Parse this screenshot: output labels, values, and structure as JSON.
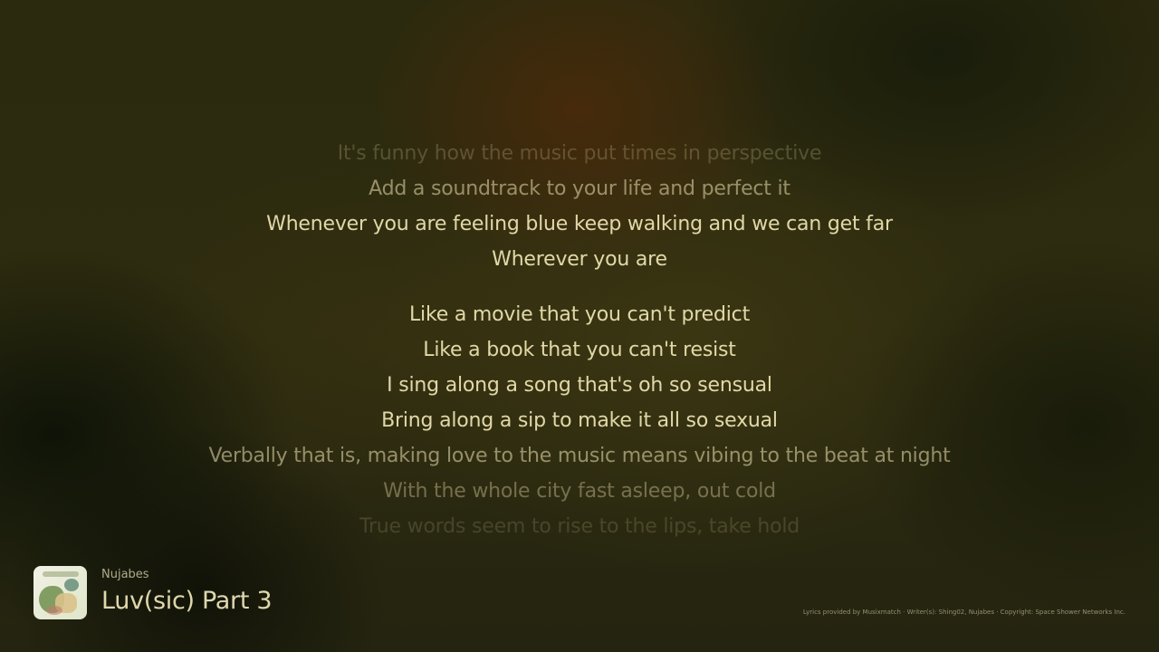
{
  "lyrics": {
    "previous": [
      "It's funny how the music put times in perspective",
      "Add a soundtrack to your life and perfect it",
      "Whenever you are feeling blue keep walking and we can get far",
      "Wherever you are"
    ],
    "current": [
      "Like a movie that you can't predict",
      "Like a book that you can't resist",
      "I sing along a song that's oh so sensual",
      "Bring along a sip to make it all so sexual",
      "Verbally that is, making love to the music means vibing to the beat at night"
    ],
    "upcoming": [
      "With the whole city fast asleep, out cold",
      "True words seem to rise to the lips, take hold"
    ]
  },
  "now_playing": {
    "artist": "Nujabes",
    "title": "Luv(sic) Part 3"
  },
  "credits": "Lyrics provided by Musixmatch · Writer(s): Shing02, Nujabes · Copyright: Space Shower Networks Inc.",
  "icons": {
    "album_art": "album-art"
  }
}
